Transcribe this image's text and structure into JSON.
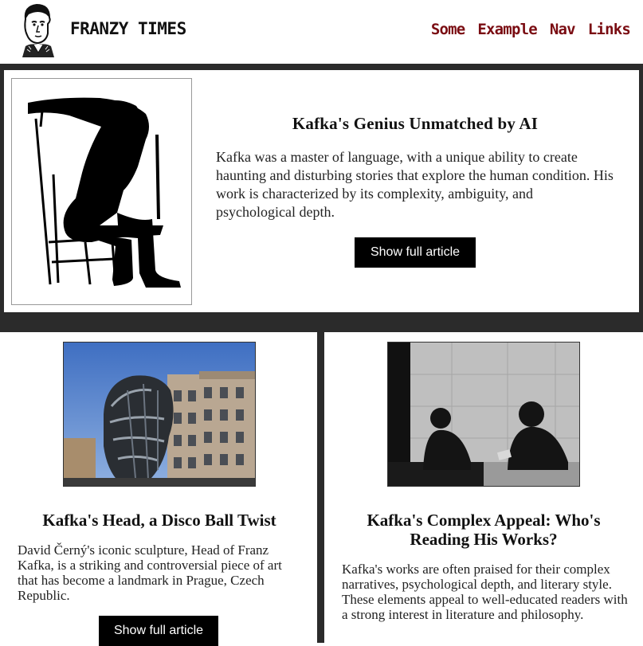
{
  "header": {
    "brand": "FRANZY TIMES",
    "nav": [
      "Some",
      "Example",
      "Nav",
      "Links"
    ]
  },
  "featured": {
    "title": "Kafka's Genius Unmatched by AI",
    "text": "Kafka was a master of language, with a unique ability to create haunting and disturbing stories that explore the human condition. His work is characterized by its complexity, ambiguity, and psychological depth.",
    "button": "Show full article"
  },
  "cards": [
    {
      "title": "Kafka's Head, a Disco Ball Twist",
      "text": "David Černý's iconic sculpture, Head of Franz Kafka, is a striking and controversial piece of art that has become a landmark in Prague, Czech Republic.",
      "button": "Show full article"
    },
    {
      "title": "Kafka's Complex Appeal: Who's Reading His Works?",
      "text": "Kafka's works are often praised for their complex narratives, psychological depth, and literary style. These elements appeal to well-educated readers with a strong interest in literature and philosophy."
    }
  ],
  "colors": {
    "nav_link": "#7a0c12",
    "band": "#2b2b2b",
    "button_bg": "#000000"
  }
}
